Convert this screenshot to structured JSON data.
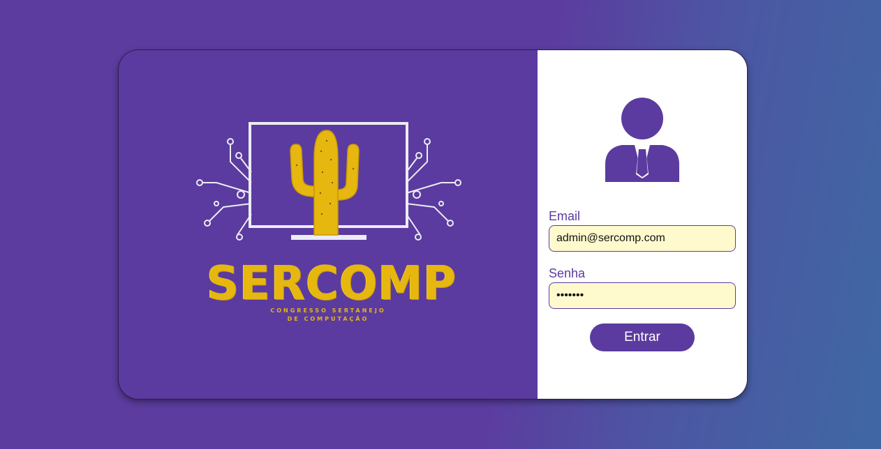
{
  "brand": {
    "name": "SERCOMP",
    "tagline_line1": "CONGRESSO SERTANEJO",
    "tagline_line2": "DE COMPUTAÇÃO",
    "colors": {
      "primary": "#5b3b9f",
      "accent": "#e6b70f",
      "input_bg": "#fffacd"
    }
  },
  "login": {
    "avatar_icon": "user-businessman-icon",
    "email_label": "Email",
    "email_value": "admin@sercomp.com",
    "password_label": "Senha",
    "password_value": "1234567",
    "submit_label": "Entrar"
  }
}
